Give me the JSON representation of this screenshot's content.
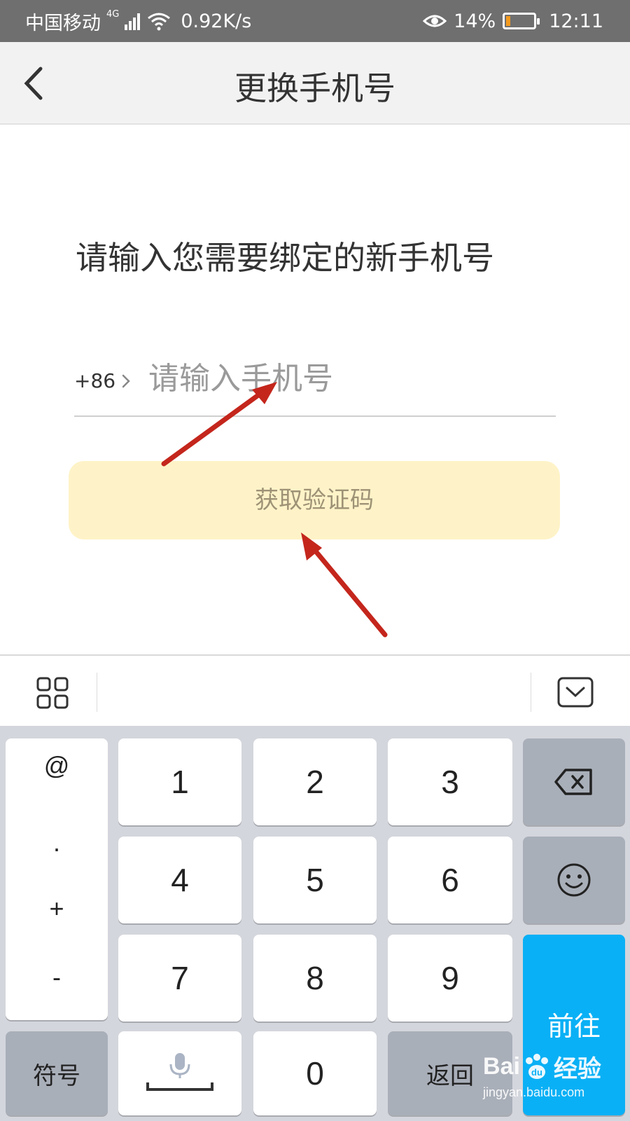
{
  "status_bar": {
    "carrier": "中国移动",
    "network": "4G",
    "speed": "0.92K/s",
    "battery": "14%",
    "time": "12:11",
    "battery_level": 0.14,
    "battery_color": "#f39a1e"
  },
  "nav": {
    "title": "更换手机号",
    "back_icon": "chevron-left-icon"
  },
  "form": {
    "prompt": "请输入您需要绑定的新手机号",
    "country_code": "+86",
    "phone_placeholder": "请输入手机号",
    "phone_value": "",
    "get_code_label": "获取验证码",
    "button_color": "#fef3c8"
  },
  "keyboard": {
    "symbols": [
      "@",
      ".",
      "+",
      "-"
    ],
    "digits": [
      "1",
      "2",
      "3",
      "4",
      "5",
      "6",
      "7",
      "8",
      "9",
      "0"
    ],
    "symbol_key": "符号",
    "back_key": "返回",
    "go_key": "前往",
    "go_color": "#0ab0f5"
  },
  "watermark": {
    "brand": "Bai",
    "brand_cn": "经验",
    "url": "jingyan.baidu.com"
  }
}
